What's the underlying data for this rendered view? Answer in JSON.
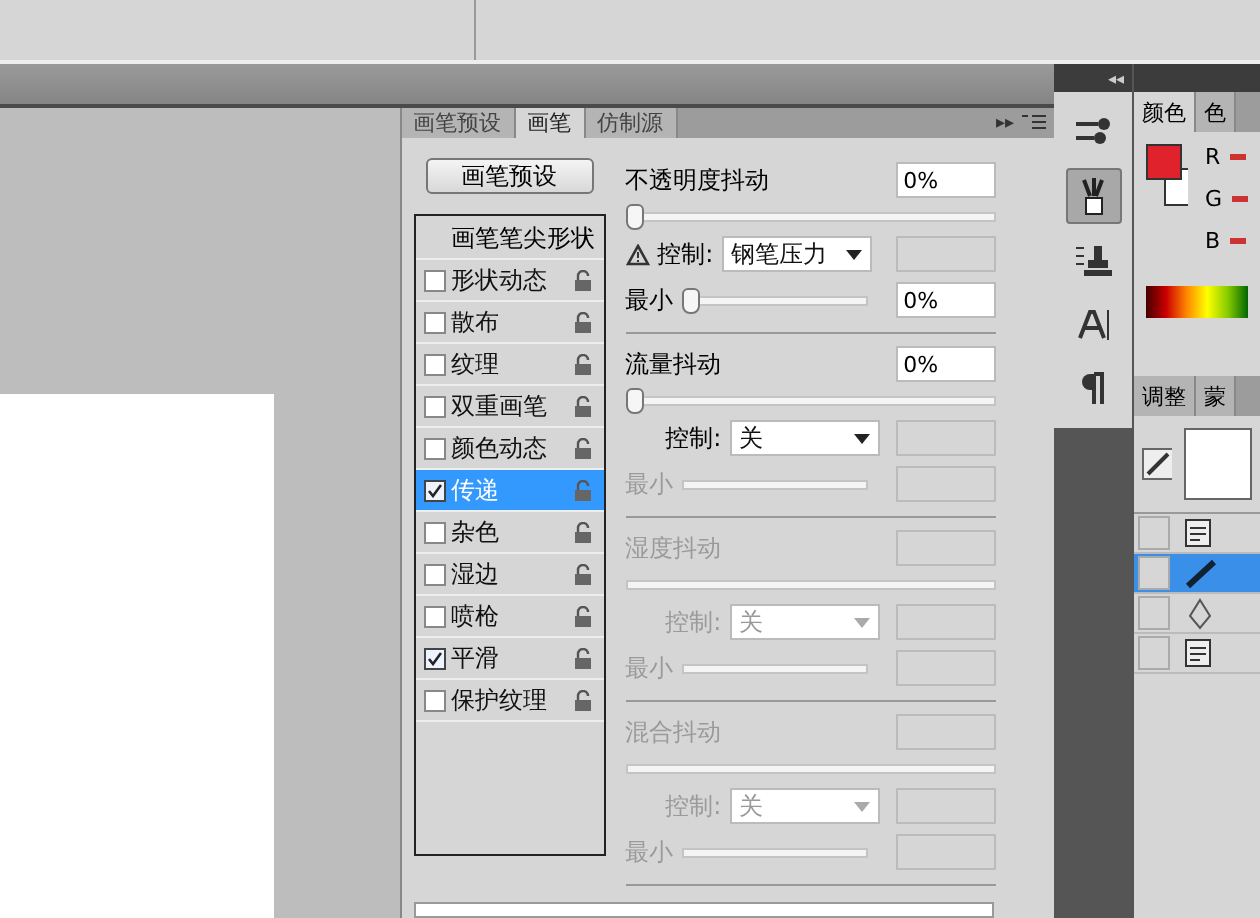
{
  "brush_panel": {
    "tabs": [
      {
        "label": "画笔预设",
        "selected": false
      },
      {
        "label": "画笔",
        "selected": true
      },
      {
        "label": "仿制源",
        "selected": false
      }
    ],
    "collapse_glyph": "▸▸",
    "preset_button": "画笔预设",
    "options": [
      {
        "kind": "tip",
        "label": "画笔笔尖形状",
        "selected": false
      },
      {
        "kind": "option",
        "label": "形状动态",
        "checked": false,
        "selected": false
      },
      {
        "kind": "option",
        "label": "散布",
        "checked": false,
        "selected": false
      },
      {
        "kind": "option",
        "label": "纹理",
        "checked": false,
        "selected": false
      },
      {
        "kind": "option",
        "label": "双重画笔",
        "checked": false,
        "selected": false
      },
      {
        "kind": "option",
        "label": "颜色动态",
        "checked": false,
        "selected": false
      },
      {
        "kind": "option",
        "label": "传递",
        "checked": true,
        "selected": true
      },
      {
        "kind": "option",
        "label": "杂色",
        "checked": false,
        "selected": false
      },
      {
        "kind": "option",
        "label": "湿边",
        "checked": false,
        "selected": false
      },
      {
        "kind": "option",
        "label": "喷枪",
        "checked": false,
        "selected": false
      },
      {
        "kind": "option",
        "label": "平滑",
        "checked": true,
        "selected": false
      },
      {
        "kind": "option",
        "label": "保护纹理",
        "checked": false,
        "selected": false
      }
    ],
    "sections": [
      {
        "label": "不透明度抖动",
        "disabled": false,
        "value": "0%",
        "level": 0,
        "control": {
          "label": "控制:",
          "value": "钢笔压力",
          "disabled": false,
          "warning": true
        },
        "minimum": {
          "label": "最小",
          "disabled": false,
          "value": "0%",
          "level": 0
        }
      },
      {
        "label": "流量抖动",
        "disabled": false,
        "value": "0%",
        "level": 0,
        "control": {
          "label": "控制:",
          "value": "关",
          "disabled": false,
          "warning": false
        },
        "minimum": {
          "label": "最小",
          "disabled": true
        }
      },
      {
        "label": "湿度抖动",
        "disabled": true,
        "control": {
          "label": "控制:",
          "value": "关",
          "disabled": true,
          "warning": false
        },
        "minimum": {
          "label": "最小",
          "disabled": true
        }
      },
      {
        "label": "混合抖动",
        "disabled": true,
        "control": {
          "label": "控制:",
          "value": "关",
          "disabled": true,
          "warning": false
        },
        "minimum": {
          "label": "最小",
          "disabled": true
        }
      }
    ]
  },
  "dock": {
    "collapse_glyph": "◂◂",
    "tools": [
      {
        "kind": "brush-settings",
        "selected": false
      },
      {
        "kind": "brush",
        "selected": true
      },
      {
        "kind": "stamp",
        "selected": false
      },
      {
        "kind": "text",
        "selected": false
      },
      {
        "kind": "paragraph",
        "selected": false
      }
    ]
  },
  "color_panel": {
    "tabs": [
      {
        "label": "颜色",
        "selected": true
      },
      {
        "label": "色",
        "selected": false
      }
    ],
    "swatches": [
      {
        "kind": "foreground",
        "color": "#e0222c"
      },
      {
        "kind": "background",
        "color": "#ffffff"
      }
    ],
    "channels": [
      "R",
      "G",
      "B"
    ]
  },
  "layers_panel": {
    "tabs": [
      {
        "label": "调整",
        "selected": false
      },
      {
        "label": "蒙",
        "selected": false
      }
    ],
    "layers": [
      {
        "kind": "text",
        "selected": false
      },
      {
        "kind": "brush",
        "selected": true
      },
      {
        "kind": "pen",
        "selected": false
      },
      {
        "kind": "text",
        "selected": false
      }
    ]
  }
}
